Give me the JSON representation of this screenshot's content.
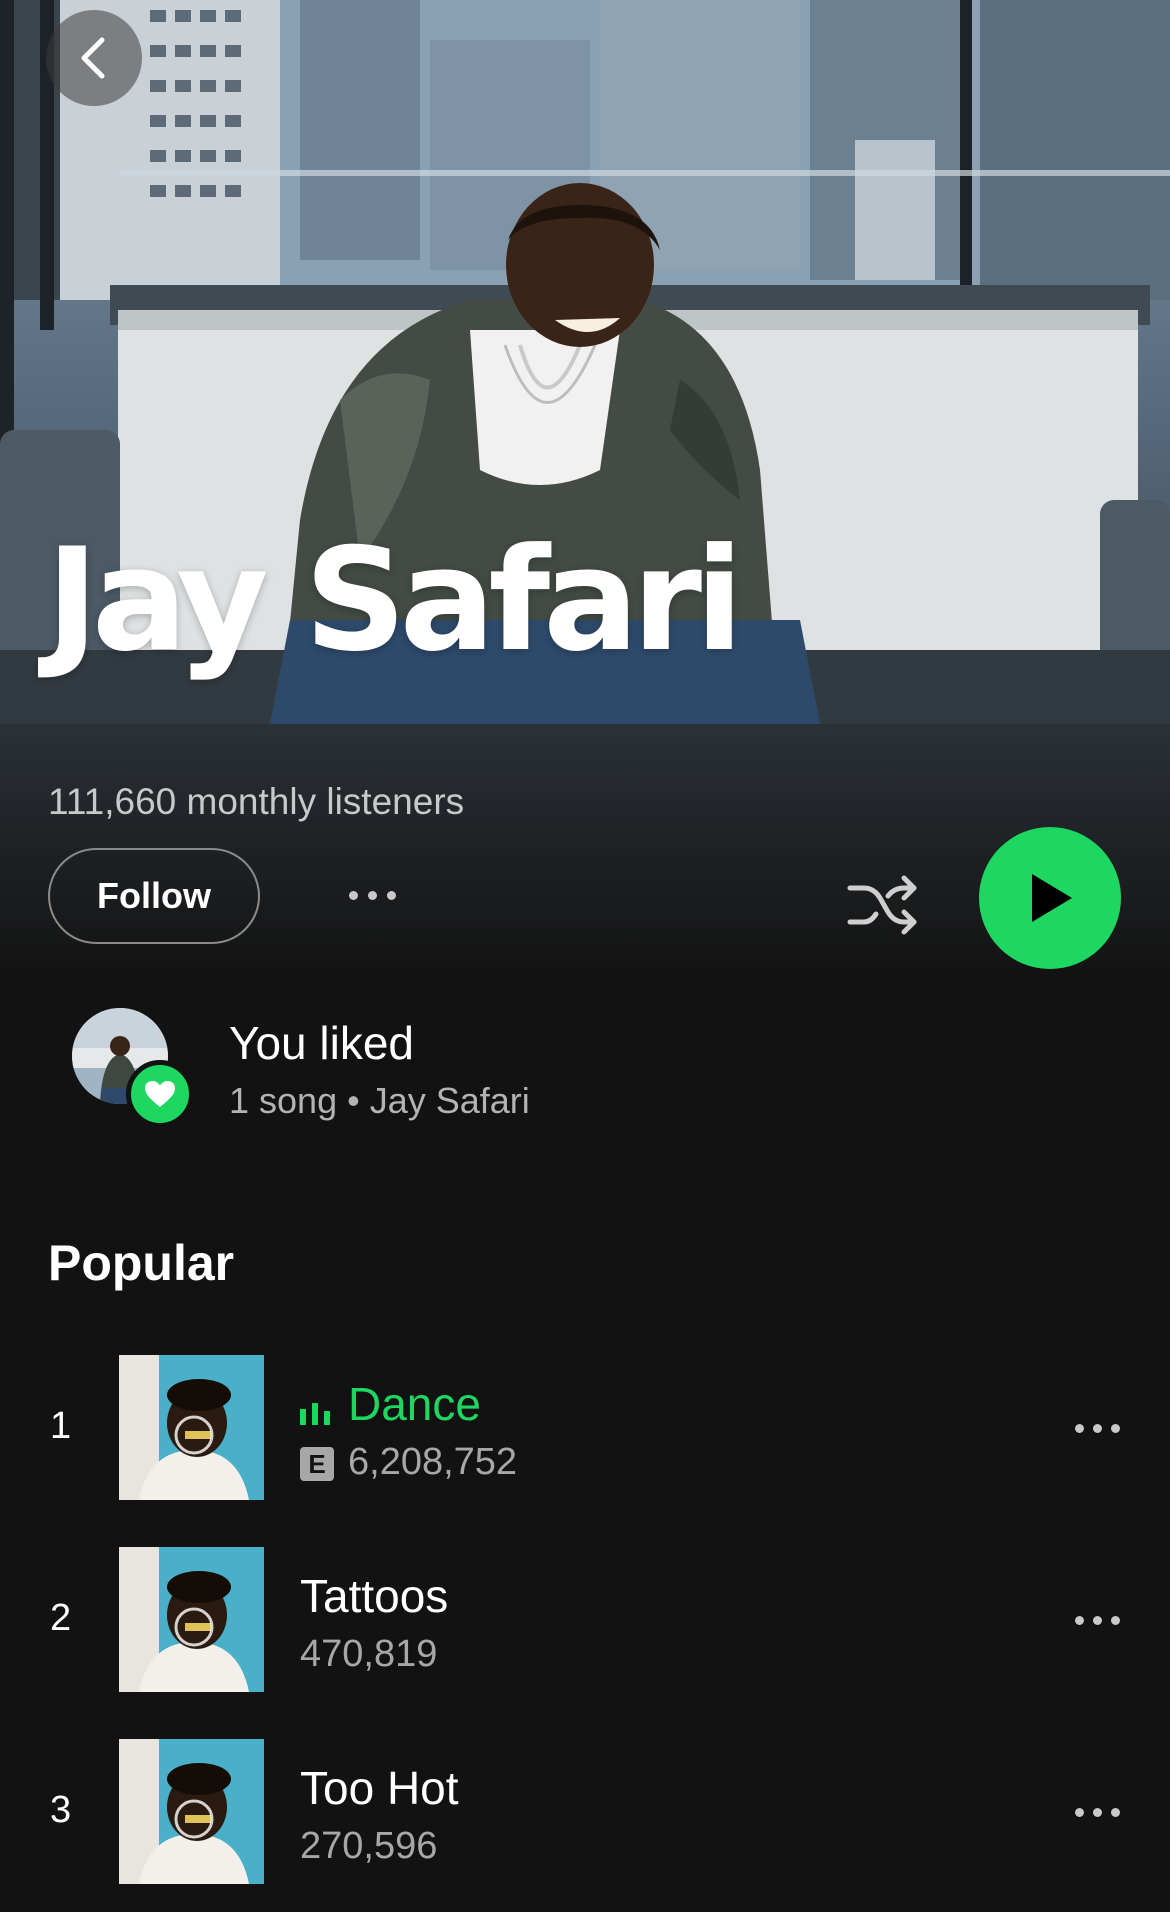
{
  "artist": {
    "name": "Jay Safari",
    "monthly_listeners": "111,660 monthly listeners"
  },
  "header": {
    "back_icon": "chevron-left-icon"
  },
  "actions": {
    "follow_label": "Follow",
    "more_icon": "more-horizontal-icon",
    "shuffle_icon": "shuffle-icon",
    "play_icon": "play-icon"
  },
  "liked": {
    "title": "You liked",
    "subtitle": "1 song • Jay Safari",
    "badge_icon": "heart-icon"
  },
  "popular": {
    "heading": "Popular",
    "tracks": [
      {
        "number": "1",
        "title": "Dance",
        "plays": "6,208,752",
        "explicit": "E",
        "playing": true
      },
      {
        "number": "2",
        "title": "Tattoos",
        "plays": "470,819",
        "explicit": "",
        "playing": false
      },
      {
        "number": "3",
        "title": "Too Hot",
        "plays": "270,596",
        "explicit": "",
        "playing": false
      }
    ]
  },
  "colors": {
    "accent": "#1ed760",
    "background": "#121212",
    "secondary_text": "#a7a7a7"
  }
}
